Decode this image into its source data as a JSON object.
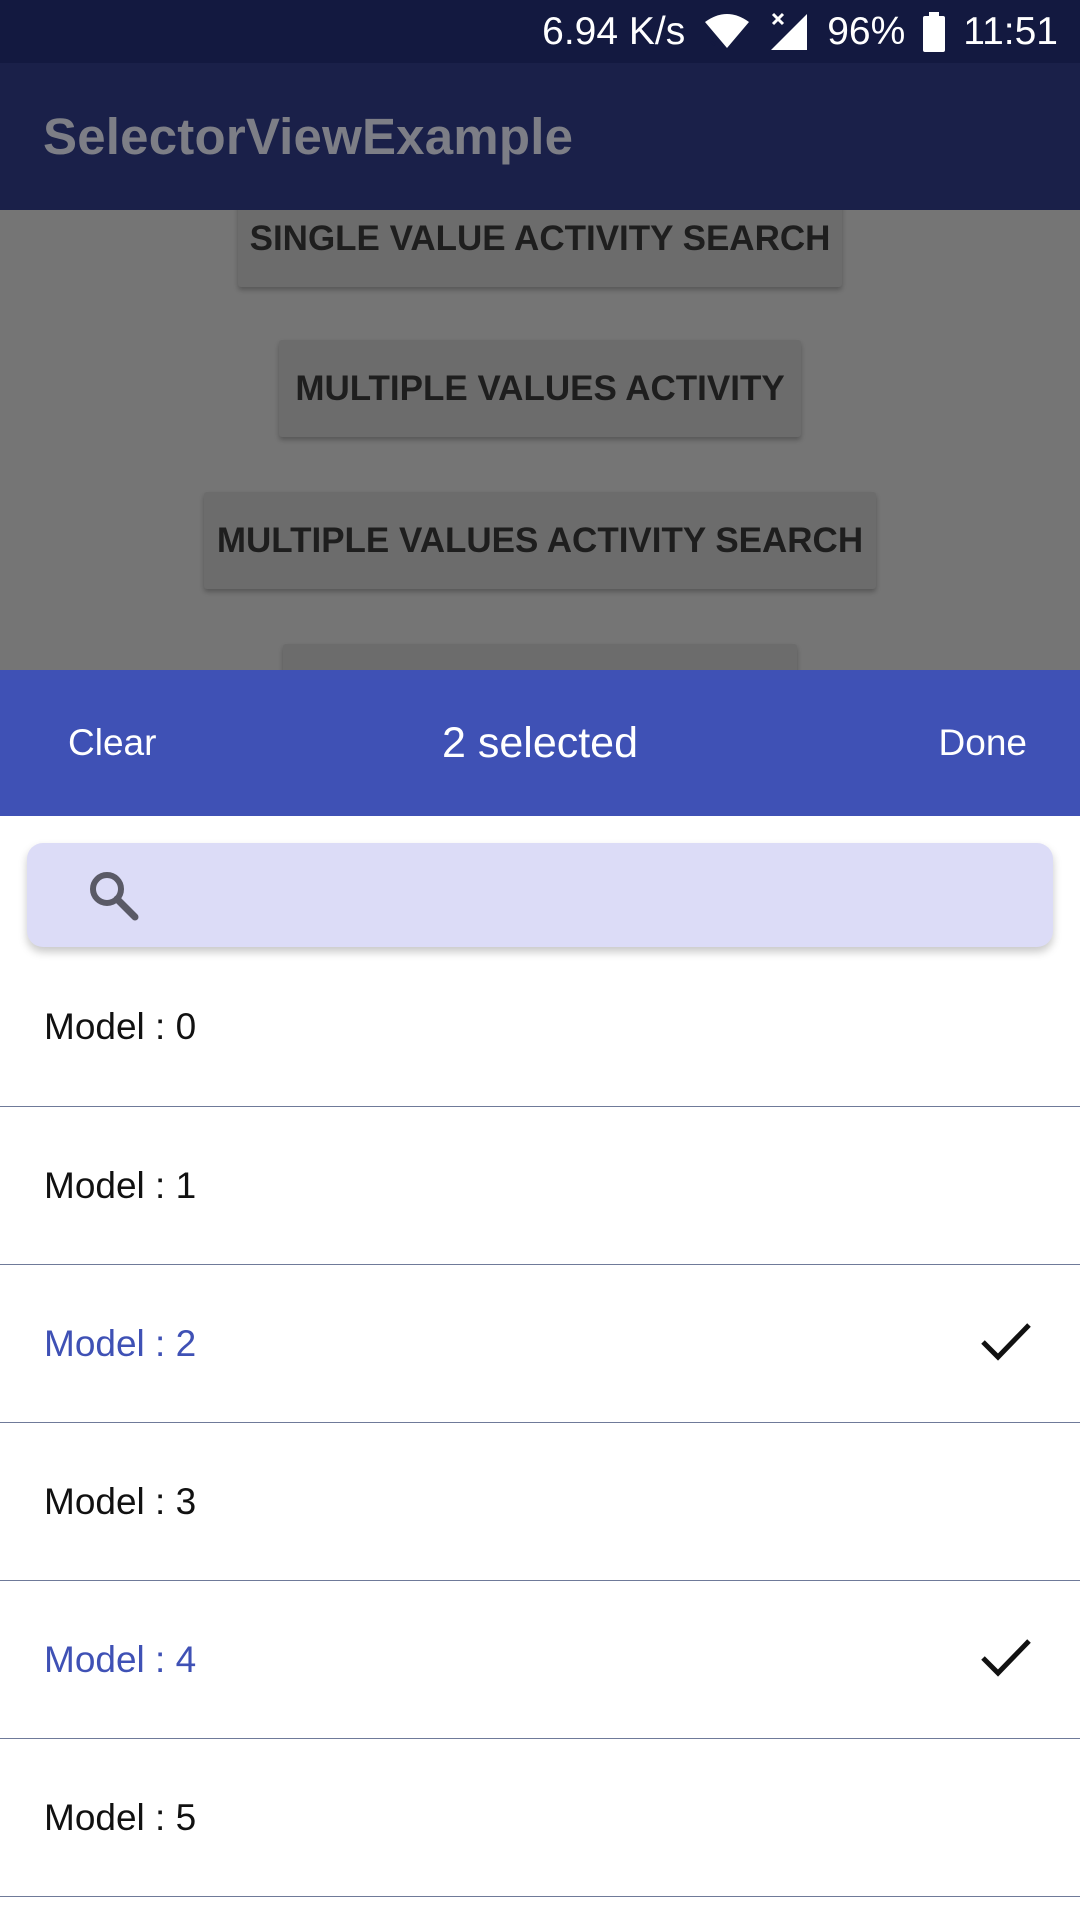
{
  "status_bar": {
    "network_speed": "6.94 K/s",
    "battery": "96%",
    "time": "11:51",
    "icons": [
      "wifi-icon",
      "signal-icon",
      "battery-icon"
    ]
  },
  "app_bar": {
    "title": "SelectorViewExample"
  },
  "background_buttons": [
    {
      "label": "SINGLE VALUE ACTIVITY SEARCH"
    },
    {
      "label": "MULTIPLE VALUES ACTIVITY"
    },
    {
      "label": "MULTIPLE VALUES ACTIVITY SEARCH"
    },
    {
      "label": ""
    }
  ],
  "sheet_header": {
    "clear_label": "Clear",
    "title": "2 selected",
    "done_label": "Done"
  },
  "search": {
    "icon": "search-icon",
    "value": "",
    "placeholder": ""
  },
  "list": {
    "items": [
      {
        "label": "Model : 0",
        "selected": false
      },
      {
        "label": "Model : 1",
        "selected": false
      },
      {
        "label": "Model : 2",
        "selected": true
      },
      {
        "label": "Model : 3",
        "selected": false
      },
      {
        "label": "Model : 4",
        "selected": true
      },
      {
        "label": "Model : 5",
        "selected": false
      }
    ]
  },
  "colors": {
    "status_bar": "#131940",
    "app_bar": "#1a2049",
    "accent": "#3f51b5",
    "search_bg": "#dcdcf7",
    "scrim": "#757575"
  }
}
